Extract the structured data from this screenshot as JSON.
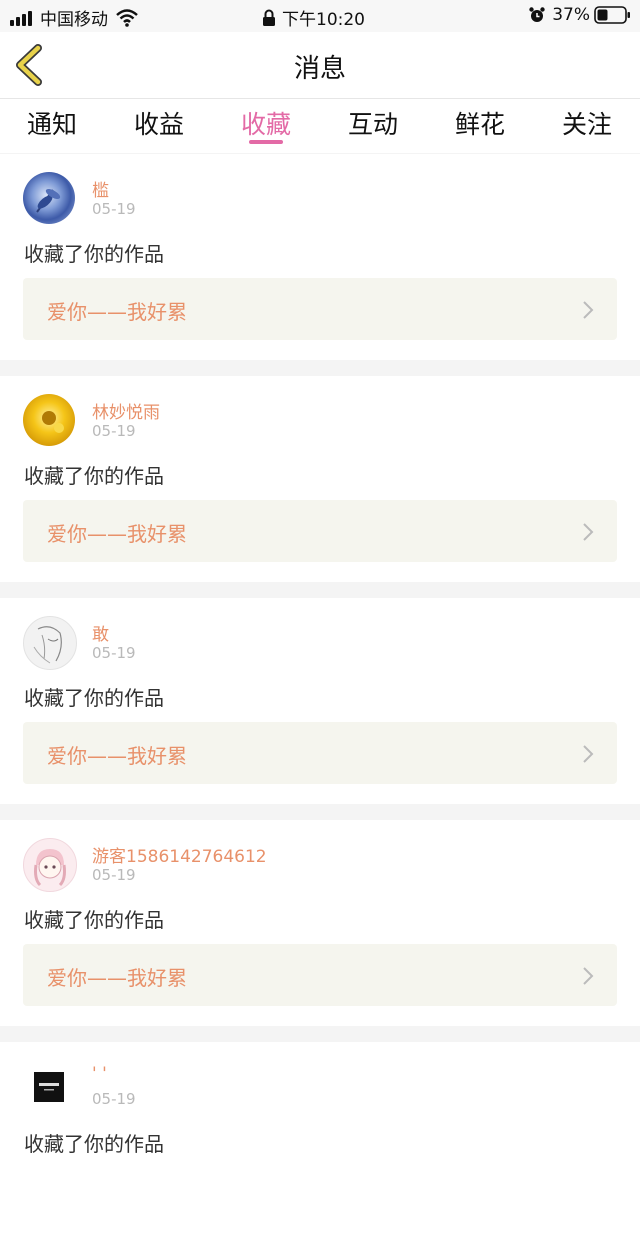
{
  "status_bar": {
    "carrier": "中国移动",
    "time": "下午10:20",
    "battery_percent": "37%"
  },
  "header": {
    "title": "消息"
  },
  "tabs": [
    {
      "label": "通知"
    },
    {
      "label": "收益"
    },
    {
      "label": "收藏",
      "active": true
    },
    {
      "label": "互动"
    },
    {
      "label": "鲜花"
    },
    {
      "label": "关注"
    }
  ],
  "messages": [
    {
      "user": "槛",
      "date": "05-19",
      "action": "收藏了你的作品",
      "work": "爱你——我好累",
      "avatar": "blue-flower-avatar"
    },
    {
      "user": "林妙悦雨",
      "date": "05-19",
      "action": "收藏了你的作品",
      "work": "爱你——我好累",
      "avatar": "yellow-flower-avatar"
    },
    {
      "user": "敢",
      "date": "05-19",
      "action": "收藏了你的作品",
      "work": "爱你——我好累",
      "avatar": "sketch-girl-avatar"
    },
    {
      "user": "游客1586142764612",
      "date": "05-19",
      "action": "收藏了你的作品",
      "work": "爱你——我好累",
      "avatar": "pink-girl-avatar"
    },
    {
      "user": "' '",
      "date": "05-19",
      "action": "收藏了你的作品",
      "work": "",
      "avatar": "black-square-avatar"
    }
  ],
  "colors": {
    "accent": "#e36aa6",
    "username": "#e8916a",
    "work_bg": "#f5f5ee",
    "back_arrow": "#e8d24a"
  }
}
